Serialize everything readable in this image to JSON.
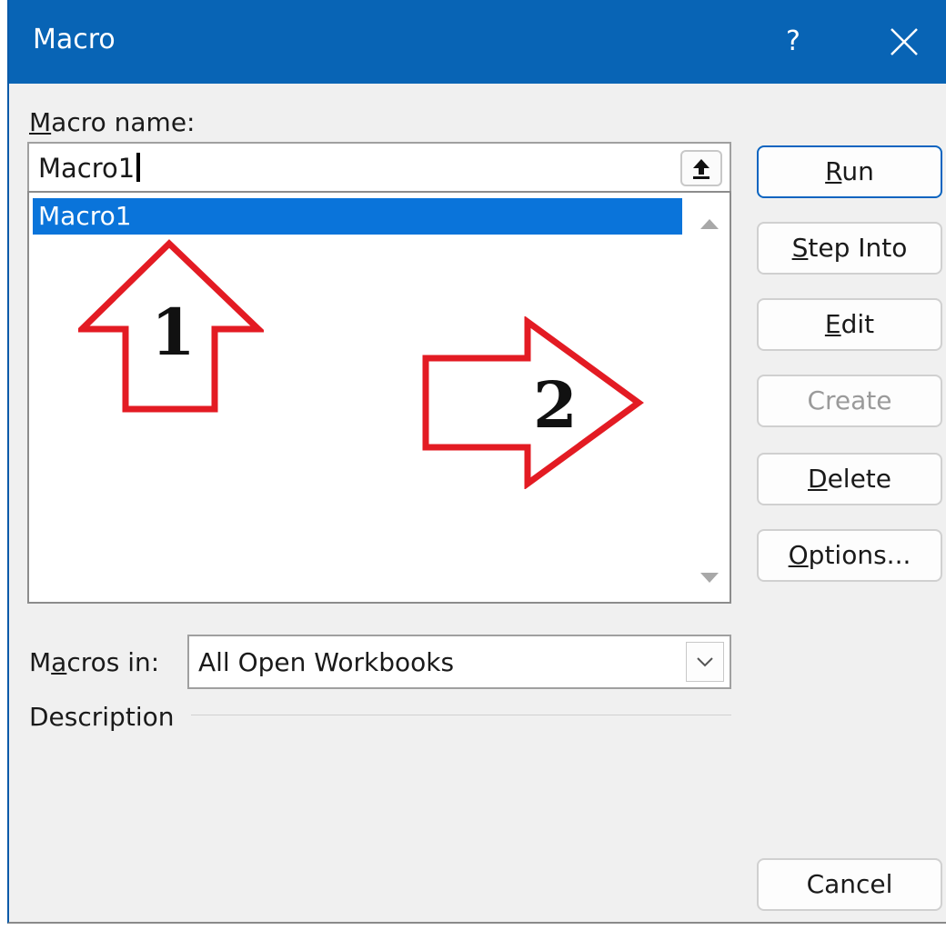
{
  "dialog": {
    "title": "Macro",
    "help_label": "?"
  },
  "macro_name": {
    "label_accel": "M",
    "label_rest": "acro name:",
    "value": "Macro1"
  },
  "macro_list": {
    "items": [
      "Macro1"
    ]
  },
  "annotations": {
    "arrow1_number": "1",
    "arrow2_number": "2",
    "color": "#e31b23"
  },
  "macros_in": {
    "label_pre": "M",
    "label_accel": "a",
    "label_post": "cros in:",
    "selected": "All Open Workbooks"
  },
  "description": {
    "label": "Description"
  },
  "buttons": {
    "run": {
      "accel": "R",
      "rest": "un"
    },
    "step_into": {
      "accel": "S",
      "rest": "tep Into"
    },
    "edit": {
      "accel": "E",
      "rest": "dit"
    },
    "create": {
      "label": "Create"
    },
    "delete": {
      "accel": "D",
      "rest": "elete"
    },
    "options": {
      "accel": "O",
      "rest": "ptions..."
    },
    "cancel": {
      "label": "Cancel"
    }
  },
  "colors": {
    "titlebar": "#0864b5",
    "selection": "#0a74da",
    "dialog_bg": "#f0f0f0"
  }
}
